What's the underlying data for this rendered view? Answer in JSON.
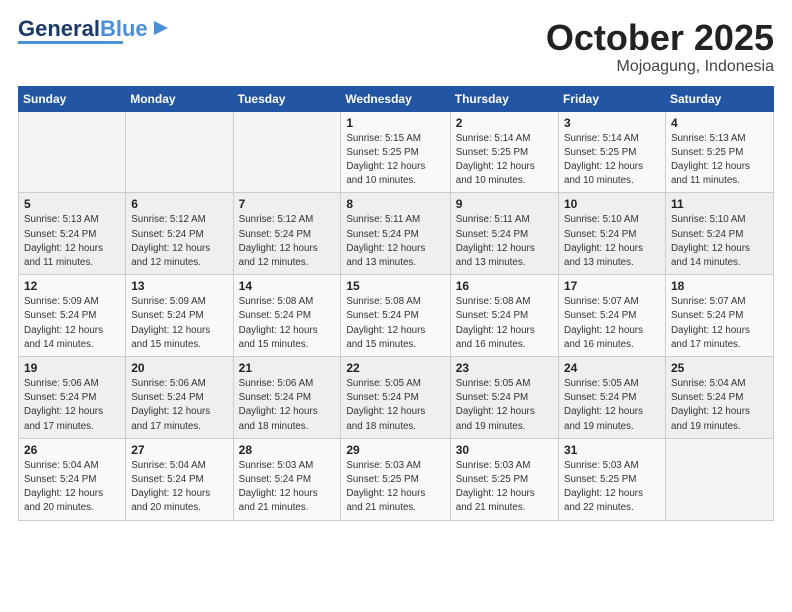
{
  "logo": {
    "text1": "General",
    "text2": "Blue"
  },
  "header": {
    "month": "October 2025",
    "location": "Mojoagung, Indonesia"
  },
  "weekdays": [
    "Sunday",
    "Monday",
    "Tuesday",
    "Wednesday",
    "Thursday",
    "Friday",
    "Saturday"
  ],
  "weeks": [
    [
      {
        "day": "",
        "info": ""
      },
      {
        "day": "",
        "info": ""
      },
      {
        "day": "",
        "info": ""
      },
      {
        "day": "1",
        "info": "Sunrise: 5:15 AM\nSunset: 5:25 PM\nDaylight: 12 hours\nand 10 minutes."
      },
      {
        "day": "2",
        "info": "Sunrise: 5:14 AM\nSunset: 5:25 PM\nDaylight: 12 hours\nand 10 minutes."
      },
      {
        "day": "3",
        "info": "Sunrise: 5:14 AM\nSunset: 5:25 PM\nDaylight: 12 hours\nand 10 minutes."
      },
      {
        "day": "4",
        "info": "Sunrise: 5:13 AM\nSunset: 5:25 PM\nDaylight: 12 hours\nand 11 minutes."
      }
    ],
    [
      {
        "day": "5",
        "info": "Sunrise: 5:13 AM\nSunset: 5:24 PM\nDaylight: 12 hours\nand 11 minutes."
      },
      {
        "day": "6",
        "info": "Sunrise: 5:12 AM\nSunset: 5:24 PM\nDaylight: 12 hours\nand 12 minutes."
      },
      {
        "day": "7",
        "info": "Sunrise: 5:12 AM\nSunset: 5:24 PM\nDaylight: 12 hours\nand 12 minutes."
      },
      {
        "day": "8",
        "info": "Sunrise: 5:11 AM\nSunset: 5:24 PM\nDaylight: 12 hours\nand 13 minutes."
      },
      {
        "day": "9",
        "info": "Sunrise: 5:11 AM\nSunset: 5:24 PM\nDaylight: 12 hours\nand 13 minutes."
      },
      {
        "day": "10",
        "info": "Sunrise: 5:10 AM\nSunset: 5:24 PM\nDaylight: 12 hours\nand 13 minutes."
      },
      {
        "day": "11",
        "info": "Sunrise: 5:10 AM\nSunset: 5:24 PM\nDaylight: 12 hours\nand 14 minutes."
      }
    ],
    [
      {
        "day": "12",
        "info": "Sunrise: 5:09 AM\nSunset: 5:24 PM\nDaylight: 12 hours\nand 14 minutes."
      },
      {
        "day": "13",
        "info": "Sunrise: 5:09 AM\nSunset: 5:24 PM\nDaylight: 12 hours\nand 15 minutes."
      },
      {
        "day": "14",
        "info": "Sunrise: 5:08 AM\nSunset: 5:24 PM\nDaylight: 12 hours\nand 15 minutes."
      },
      {
        "day": "15",
        "info": "Sunrise: 5:08 AM\nSunset: 5:24 PM\nDaylight: 12 hours\nand 15 minutes."
      },
      {
        "day": "16",
        "info": "Sunrise: 5:08 AM\nSunset: 5:24 PM\nDaylight: 12 hours\nand 16 minutes."
      },
      {
        "day": "17",
        "info": "Sunrise: 5:07 AM\nSunset: 5:24 PM\nDaylight: 12 hours\nand 16 minutes."
      },
      {
        "day": "18",
        "info": "Sunrise: 5:07 AM\nSunset: 5:24 PM\nDaylight: 12 hours\nand 17 minutes."
      }
    ],
    [
      {
        "day": "19",
        "info": "Sunrise: 5:06 AM\nSunset: 5:24 PM\nDaylight: 12 hours\nand 17 minutes."
      },
      {
        "day": "20",
        "info": "Sunrise: 5:06 AM\nSunset: 5:24 PM\nDaylight: 12 hours\nand 17 minutes."
      },
      {
        "day": "21",
        "info": "Sunrise: 5:06 AM\nSunset: 5:24 PM\nDaylight: 12 hours\nand 18 minutes."
      },
      {
        "day": "22",
        "info": "Sunrise: 5:05 AM\nSunset: 5:24 PM\nDaylight: 12 hours\nand 18 minutes."
      },
      {
        "day": "23",
        "info": "Sunrise: 5:05 AM\nSunset: 5:24 PM\nDaylight: 12 hours\nand 19 minutes."
      },
      {
        "day": "24",
        "info": "Sunrise: 5:05 AM\nSunset: 5:24 PM\nDaylight: 12 hours\nand 19 minutes."
      },
      {
        "day": "25",
        "info": "Sunrise: 5:04 AM\nSunset: 5:24 PM\nDaylight: 12 hours\nand 19 minutes."
      }
    ],
    [
      {
        "day": "26",
        "info": "Sunrise: 5:04 AM\nSunset: 5:24 PM\nDaylight: 12 hours\nand 20 minutes."
      },
      {
        "day": "27",
        "info": "Sunrise: 5:04 AM\nSunset: 5:24 PM\nDaylight: 12 hours\nand 20 minutes."
      },
      {
        "day": "28",
        "info": "Sunrise: 5:03 AM\nSunset: 5:24 PM\nDaylight: 12 hours\nand 21 minutes."
      },
      {
        "day": "29",
        "info": "Sunrise: 5:03 AM\nSunset: 5:25 PM\nDaylight: 12 hours\nand 21 minutes."
      },
      {
        "day": "30",
        "info": "Sunrise: 5:03 AM\nSunset: 5:25 PM\nDaylight: 12 hours\nand 21 minutes."
      },
      {
        "day": "31",
        "info": "Sunrise: 5:03 AM\nSunset: 5:25 PM\nDaylight: 12 hours\nand 22 minutes."
      },
      {
        "day": "",
        "info": ""
      }
    ]
  ]
}
